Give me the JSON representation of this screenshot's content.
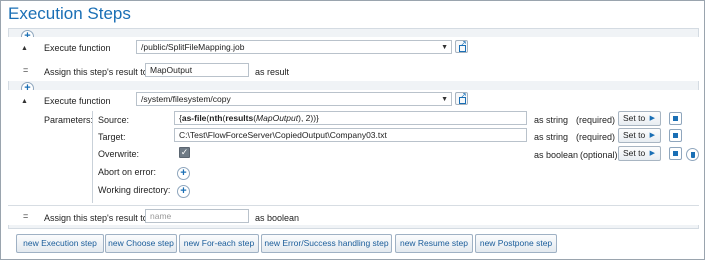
{
  "title": "Execution Steps",
  "step1": {
    "execute_label": "Execute function",
    "function_path": "/public/SplitFileMapping.job",
    "assign_label": "Assign this step's result to",
    "result_value": "MapOutput",
    "result_suffix": "as result"
  },
  "step2": {
    "execute_label": "Execute function",
    "function_path": "/system/filesystem/copy",
    "parameters_label": "Parameters:",
    "params": [
      {
        "name": "Source:",
        "type": "as string",
        "req": "(required)",
        "set": "Set to"
      },
      {
        "name": "Target:",
        "value": "C:\\Test\\FlowForceServer\\CopiedOutput\\Company03.txt",
        "type": "as string",
        "req": "(required)",
        "set": "Set to"
      },
      {
        "name": "Overwrite:",
        "checked": true,
        "type": "as boolean",
        "req": "(optional)",
        "set": "Set to"
      },
      {
        "name": "Abort on error:"
      },
      {
        "name": "Working directory:"
      }
    ],
    "source_expr": {
      "p1": "{",
      "f1": "as-file",
      "p2": "(",
      "f2": "nth",
      "p3": "(",
      "f3": "results",
      "p4": "(",
      "arg": "MapOutput",
      "p5": "), 2))}"
    },
    "assign_label": "Assign this step's result to",
    "result_placeholder": "name",
    "result_suffix": "as boolean"
  },
  "buttons": [
    "new Execution step",
    "new Choose step",
    "new For-each step",
    "new Error/Success handling step",
    "new Resume step",
    "new Postpone step"
  ],
  "glyphs": {
    "plus": "+",
    "caret": "▲",
    "equals": "=",
    "dropdown": "▼",
    "play": "▶",
    "check": "✓"
  },
  "colors": {
    "accent": "#1a6fb5",
    "panel_bg": "#f0f3f6"
  }
}
